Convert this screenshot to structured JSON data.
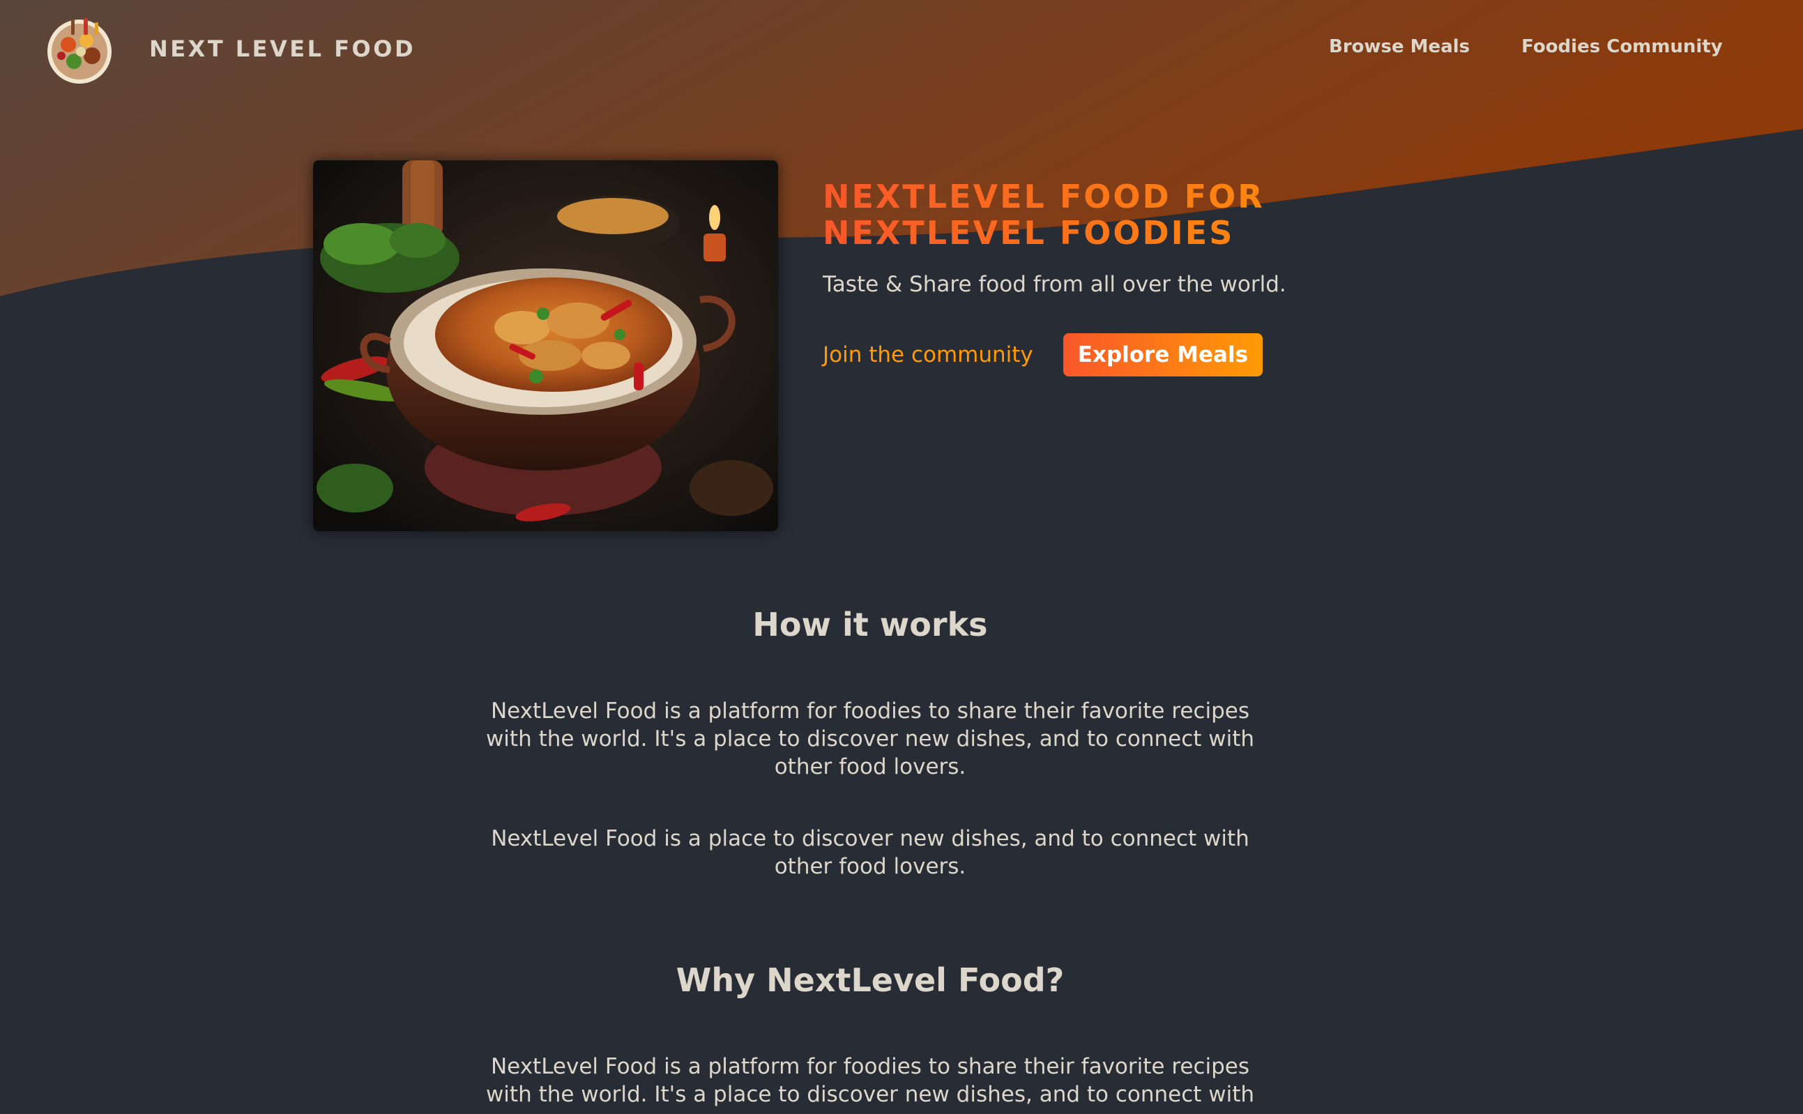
{
  "header": {
    "brand": "NEXT LEVEL FOOD",
    "logo_icon": "plate-of-food-icon",
    "nav": [
      {
        "label": "Browse Meals"
      },
      {
        "label": "Foodies Community"
      }
    ]
  },
  "hero": {
    "image_icon": "curry-dish-image",
    "title_line1": "NEXTLEVEL FOOD FOR",
    "title_line2": "NEXTLEVEL FOODIES",
    "subtitle": "Taste & Share food from all over the world.",
    "community_link": "Join the community",
    "explore_button": "Explore Meals"
  },
  "sections": [
    {
      "heading": "How it works",
      "paragraphs": [
        "NextLevel Food is a platform for foodies to share their favorite recipes with the world. It's a place to discover new dishes, and to connect with other food lovers.",
        "NextLevel Food is a place to discover new dishes, and to connect with other food lovers."
      ]
    },
    {
      "heading": "Why NextLevel Food?",
      "paragraphs": [
        "NextLevel Food is a platform for foodies to share their favorite recipes with the world. It's a place to discover new dishes, and to connect with"
      ]
    }
  ],
  "colors": {
    "page_background": "#282c34",
    "text": "#ddd6cb",
    "accent_start": "#f9572a",
    "accent_end": "#ff9b05",
    "header_gradient_start": "#59453c",
    "header_gradient_end": "#8f3a09"
  }
}
